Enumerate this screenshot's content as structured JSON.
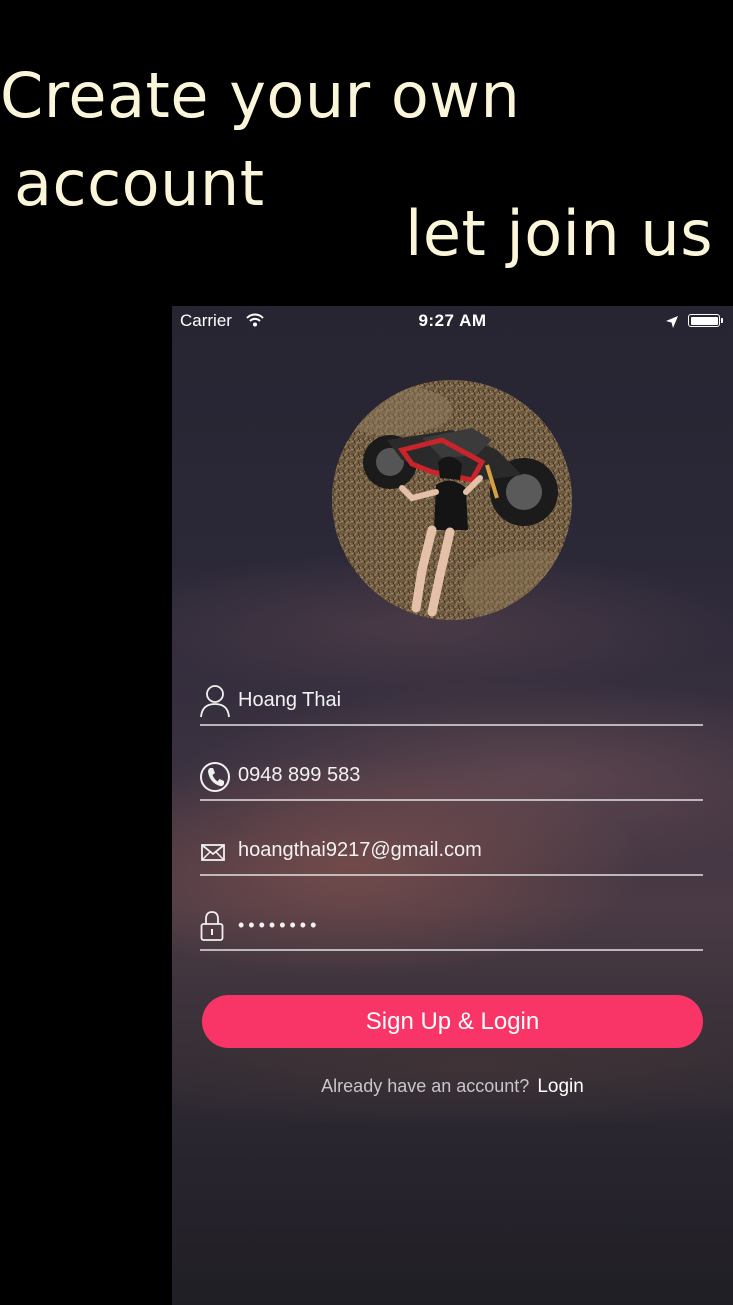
{
  "promo": {
    "line1": "Create your own",
    "line2": "account",
    "line3": "let join us"
  },
  "status_bar": {
    "carrier": "Carrier",
    "time": "9:27 AM",
    "icons": [
      "wifi-icon",
      "location-arrow-icon",
      "battery-icon"
    ]
  },
  "form": {
    "name": {
      "icon": "user-icon",
      "value": "Hoang Thai"
    },
    "phone": {
      "icon": "phone-icon",
      "value": "0948 899 583"
    },
    "email": {
      "icon": "mail-icon",
      "value": "hoangthai9217@gmail.com"
    },
    "password": {
      "icon": "lock-icon",
      "value": "••••••••"
    }
  },
  "signup_button": {
    "label": "Sign Up & Login"
  },
  "footer": {
    "prompt": "Already have an account?",
    "login_link": "Login"
  },
  "colors": {
    "accent": "#f93567",
    "promo_text": "#fbf6d9"
  }
}
